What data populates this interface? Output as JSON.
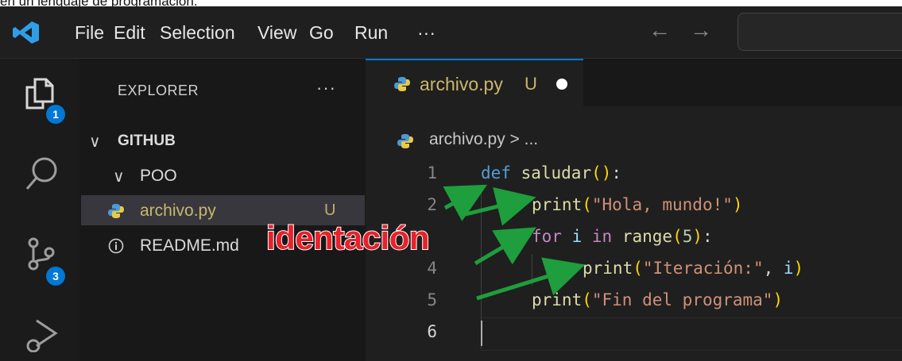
{
  "caption": "en un lenguaje de programación.",
  "menubar": [
    "File",
    "Edit",
    "Selection",
    "View",
    "Go",
    "Run",
    "···"
  ],
  "nav": {
    "back": "←",
    "forward": "→"
  },
  "activity_badges": {
    "explorer": "1",
    "source_control": "3"
  },
  "sidebar": {
    "title": "EXPLORER",
    "more": "···",
    "workspace": "GITHUB",
    "folder": "POO",
    "files": [
      {
        "name": "archivo.py",
        "status": "U"
      },
      {
        "name": "README.md"
      }
    ]
  },
  "editor": {
    "tab": {
      "label": "archivo.py",
      "status": "U"
    },
    "breadcrumb": "archivo.py > ...",
    "line_numbers": [
      "1",
      "2",
      "3",
      "4",
      "5",
      "6"
    ]
  },
  "annotation": {
    "text": "identación",
    "color": "#e8212a",
    "arrow_color": "#1e9e3c"
  },
  "colors": {
    "accent": "#0078d4",
    "background": "#1f1f1f",
    "untracked": "#c9b76b"
  }
}
